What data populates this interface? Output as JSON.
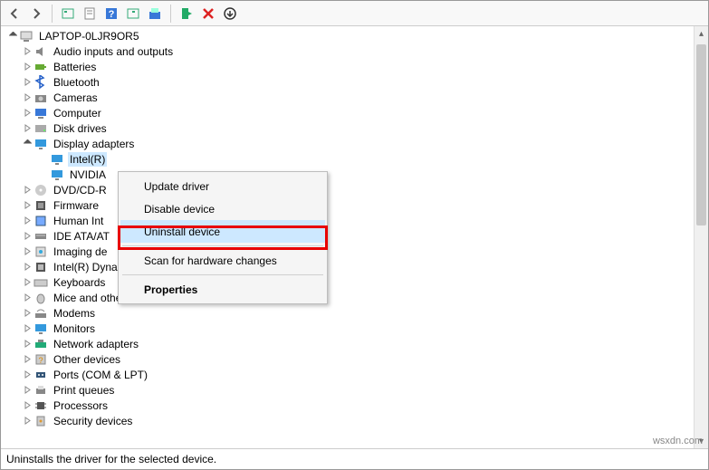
{
  "toolbar": {
    "back": "Back",
    "forward": "Forward"
  },
  "root": {
    "label": "LAPTOP-0LJR9OR5"
  },
  "categories": [
    {
      "id": "audio",
      "label": "Audio inputs and outputs",
      "expanded": false
    },
    {
      "id": "batteries",
      "label": "Batteries",
      "expanded": false
    },
    {
      "id": "bluetooth",
      "label": "Bluetooth",
      "expanded": false
    },
    {
      "id": "cameras",
      "label": "Cameras",
      "expanded": false
    },
    {
      "id": "computer",
      "label": "Computer",
      "expanded": false
    },
    {
      "id": "diskdrives",
      "label": "Disk drives",
      "expanded": false
    },
    {
      "id": "display",
      "label": "Display adapters",
      "expanded": true
    },
    {
      "id": "dvdcd",
      "label": "DVD/CD-R",
      "expanded": false
    },
    {
      "id": "firmware",
      "label": "Firmware",
      "expanded": false
    },
    {
      "id": "human",
      "label": "Human Int",
      "expanded": false
    },
    {
      "id": "ide",
      "label": "IDE ATA/AT",
      "expanded": false
    },
    {
      "id": "imaging",
      "label": "Imaging de",
      "expanded": false
    },
    {
      "id": "dptf",
      "label": "Intel(R) Dynamic Platform and Thermal Framework",
      "expanded": false
    },
    {
      "id": "keyboards",
      "label": "Keyboards",
      "expanded": false
    },
    {
      "id": "mice",
      "label": "Mice and other pointing devices",
      "expanded": false
    },
    {
      "id": "modems",
      "label": "Modems",
      "expanded": false
    },
    {
      "id": "monitors",
      "label": "Monitors",
      "expanded": false
    },
    {
      "id": "network",
      "label": "Network adapters",
      "expanded": false
    },
    {
      "id": "other",
      "label": "Other devices",
      "expanded": false
    },
    {
      "id": "ports",
      "label": "Ports (COM & LPT)",
      "expanded": false
    },
    {
      "id": "printq",
      "label": "Print queues",
      "expanded": false
    },
    {
      "id": "processors",
      "label": "Processors",
      "expanded": false
    },
    {
      "id": "security",
      "label": "Security devices",
      "expanded": false
    }
  ],
  "display_children": [
    {
      "id": "intel",
      "label": "Intel(R)",
      "selected": true
    },
    {
      "id": "nvidia",
      "label": "NVIDIA",
      "selected": false
    }
  ],
  "context_menu": [
    {
      "id": "update",
      "label": "Update driver",
      "type": "item"
    },
    {
      "id": "disable",
      "label": "Disable device",
      "type": "item"
    },
    {
      "id": "uninstall",
      "label": "Uninstall device",
      "type": "item",
      "hover": true
    },
    {
      "type": "sep"
    },
    {
      "id": "scan",
      "label": "Scan for hardware changes",
      "type": "item"
    },
    {
      "type": "sep"
    },
    {
      "id": "props",
      "label": "Properties",
      "type": "item",
      "bold": true
    }
  ],
  "status_text": "Uninstalls the driver for the selected device.",
  "watermark": "wsxdn.com"
}
